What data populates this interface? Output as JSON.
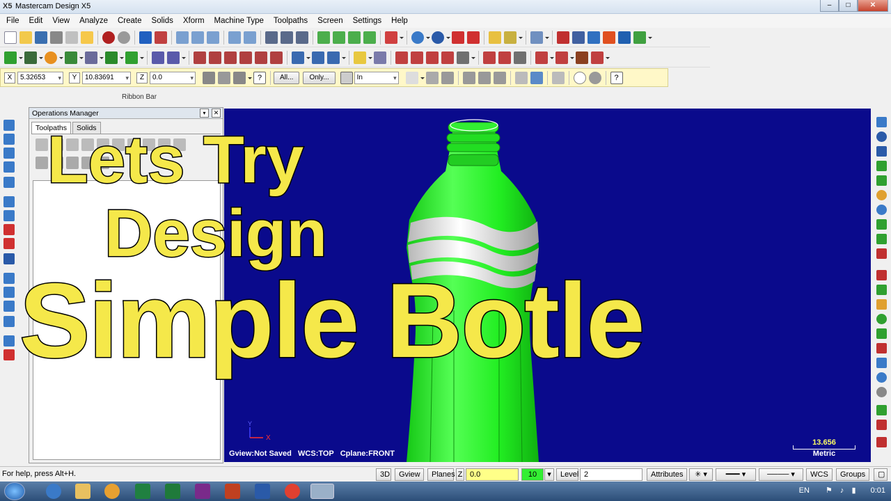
{
  "window": {
    "app_icon": "X5",
    "title": "Mastercam Design X5",
    "minimize": "–",
    "maximize": "□",
    "close": "✕"
  },
  "menu": [
    "File",
    "Edit",
    "View",
    "Analyze",
    "Create",
    "Solids",
    "Xform",
    "Machine Type",
    "Toolpaths",
    "Screen",
    "Settings",
    "Help"
  ],
  "coords": {
    "x_label": "X",
    "x_value": "5.32653",
    "y_label": "Y",
    "y_value": "10.83691",
    "z_label": "Z",
    "z_value": "0.0"
  },
  "ribbon": {
    "all_button": "All...",
    "only_button": "Only...",
    "mode_value": "In",
    "label": "Ribbon Bar"
  },
  "ops_manager": {
    "title": "Operations Manager",
    "tabs": [
      "Toolpaths",
      "Solids"
    ]
  },
  "viewport": {
    "info": "Gview:Not Saved   WCS:TOP   Cplane:FRONT",
    "scale_value": "13.656",
    "scale_unit": "Metric",
    "axis_x": "X",
    "axis_y": "Y"
  },
  "overlay": {
    "line1": "Lets Try",
    "line2": "Design",
    "line3": "Simple Botle"
  },
  "status": {
    "help": "For help, press Alt+H.",
    "btn_3d": "3D",
    "gview": "Gview",
    "planes": "Planes",
    "z_label": "Z",
    "z_value": "0.0",
    "color_value": "10",
    "level_label": "Level",
    "level_value": "2",
    "attributes": "Attributes",
    "wcs": "WCS",
    "groups": "Groups"
  },
  "taskbar": {
    "lang": "EN",
    "time": "0:01"
  },
  "colors": {
    "viewport_bg": "#0a0a8c",
    "bottle_green": "#22ee22",
    "overlay_text": "#f5e84a",
    "ribbon_bg": "#fff8c8"
  }
}
